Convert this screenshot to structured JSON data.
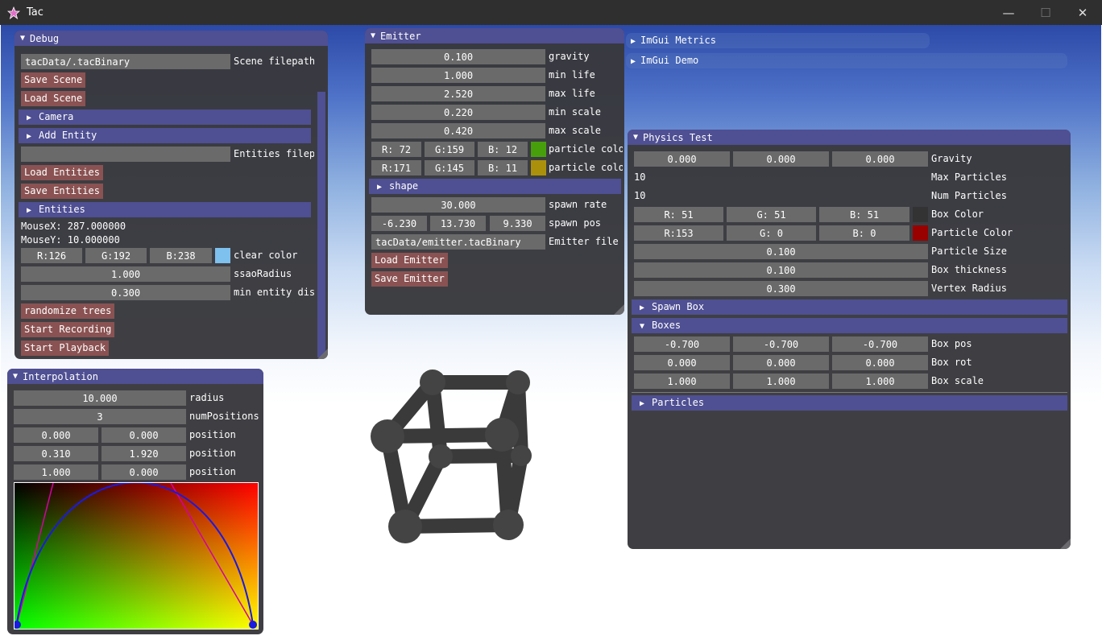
{
  "app": {
    "title": "Tac"
  },
  "window_controls": {
    "minimize": "—",
    "maximize": "☐",
    "close": "✕"
  },
  "debug": {
    "title": "Debug",
    "scene_value": "tacData/.tacBinary",
    "scene_label": "Scene filepath",
    "save_scene": "Save Scene",
    "load_scene": "Load Scene",
    "camera": "Camera",
    "add_entity": "Add Entity",
    "entities_value": "",
    "entities_label": "Entities filep",
    "load_entities": "Load Entities",
    "save_entities": "Save Entities",
    "entities": "Entities",
    "mousex": "MouseX: 287.000000",
    "mousey": "MouseY: 10.000000",
    "clear_r": "R:126",
    "clear_g": "G:192",
    "clear_b": "B:238",
    "clear_label": "clear color",
    "clear_color": "#7ec0ee",
    "ssao_value": "1.000",
    "ssao_label": "ssaoRadius",
    "minent_value": "0.300",
    "minent_label": "min entity dis",
    "randomize": "randomize trees",
    "start_recording": "Start Recording",
    "start_playback": "Start Playback"
  },
  "interpolation": {
    "title": "Interpolation",
    "radius_value": "10.000",
    "radius_label": "radius",
    "numpos_value": "3",
    "numpos_label": "numPositions",
    "positions": [
      {
        "a": "0.000",
        "b": "0.000",
        "label": "position"
      },
      {
        "a": "0.310",
        "b": "1.920",
        "label": "position"
      },
      {
        "a": "1.000",
        "b": "0.000",
        "label": "position"
      }
    ]
  },
  "emitter": {
    "title": "Emitter",
    "gravity_value": "0.100",
    "gravity_label": "gravity",
    "minlife_value": "1.000",
    "minlife_label": "min life",
    "maxlife_value": "2.520",
    "maxlife_label": "max life",
    "minscale_value": "0.220",
    "minscale_label": "min scale",
    "maxscale_value": "0.420",
    "maxscale_label": "max scale",
    "pc1_r": "R: 72",
    "pc1_g": "G:159",
    "pc1_b": "B: 12",
    "pc1_label": "particle colo",
    "pc1_color": "#489f0c",
    "pc2_r": "R:171",
    "pc2_g": "G:145",
    "pc2_b": "B: 11",
    "pc2_label": "particle colo",
    "pc2_color": "#ab910b",
    "shape": "shape",
    "spawnrate_value": "30.000",
    "spawnrate_label": "spawn rate",
    "spawnpos_x": "-6.230",
    "spawnpos_y": "13.730",
    "spawnpos_z": "9.330",
    "spawnpos_label": "spawn pos",
    "file_value": "tacData/emitter.tacBinary",
    "file_label": "Emitter file",
    "load": "Load Emitter",
    "save": "Save Emitter"
  },
  "imgui_metrics": "ImGui Metrics",
  "imgui_demo": "ImGui Demo",
  "physics": {
    "title": "Physics Test",
    "gravity": [
      "0.000",
      "0.000",
      "0.000"
    ],
    "gravity_label": "Gravity",
    "maxp_value": "10",
    "maxp_label": "Max Particles",
    "nump_value": "10",
    "nump_label": "Num Particles",
    "box_r": "R: 51",
    "box_g": "G: 51",
    "box_b": "B: 51",
    "box_label": "Box Color",
    "box_color": "#333333",
    "part_r": "R:153",
    "part_g": "G:  0",
    "part_b": "B:  0",
    "part_label": "Particle Color",
    "part_color": "#990000",
    "psize_value": "0.100",
    "psize_label": "Particle Size",
    "bthick_value": "0.100",
    "bthick_label": "Box thickness",
    "vrad_value": "0.300",
    "vrad_label": "Vertex Radius",
    "spawn_box": "Spawn Box",
    "boxes": "Boxes",
    "boxpos": [
      "-0.700",
      "-0.700",
      "-0.700"
    ],
    "boxpos_label": "Box pos",
    "boxrot": [
      "0.000",
      "0.000",
      "0.000"
    ],
    "boxrot_label": "Box rot",
    "boxscale": [
      "1.000",
      "1.000",
      "1.000"
    ],
    "boxscale_label": "Box scale",
    "particles": "Particles"
  }
}
